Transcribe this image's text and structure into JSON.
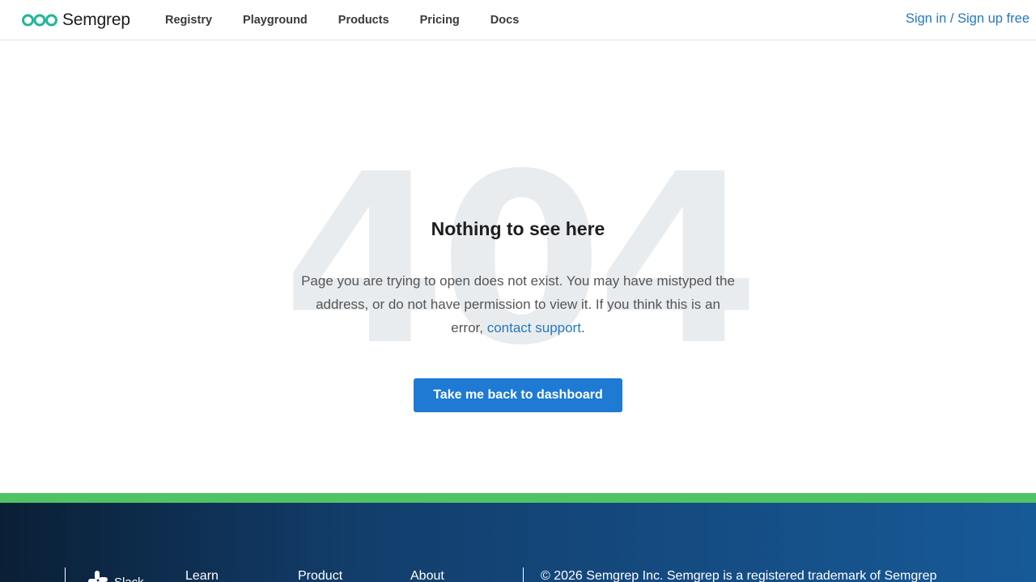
{
  "header": {
    "logo_text": "Semgrep",
    "nav": [
      "Registry",
      "Playground",
      "Products",
      "Pricing",
      "Docs"
    ],
    "signin": "Sign in / Sign up free"
  },
  "main": {
    "bg_code": "404",
    "title": "Nothing to see here",
    "message_part1": "Page you are trying to open does not exist. You may have mistyped the address, or do not have permission to view it. If you think this is an error, ",
    "support_link": "contact support",
    "message_part2": ".",
    "back_button": "Take me back to dashboard"
  },
  "footer": {
    "slack": "Slack",
    "columns": [
      "Learn",
      "Product",
      "About"
    ],
    "copyright": "© 2026 Semgrep Inc. Semgrep is a registered trademark of Semgrep"
  },
  "colors": {
    "accent": "#1e7ad3",
    "link": "#2479c2",
    "logo_green": "#1fb79a",
    "footer_green": "#4fc464"
  }
}
